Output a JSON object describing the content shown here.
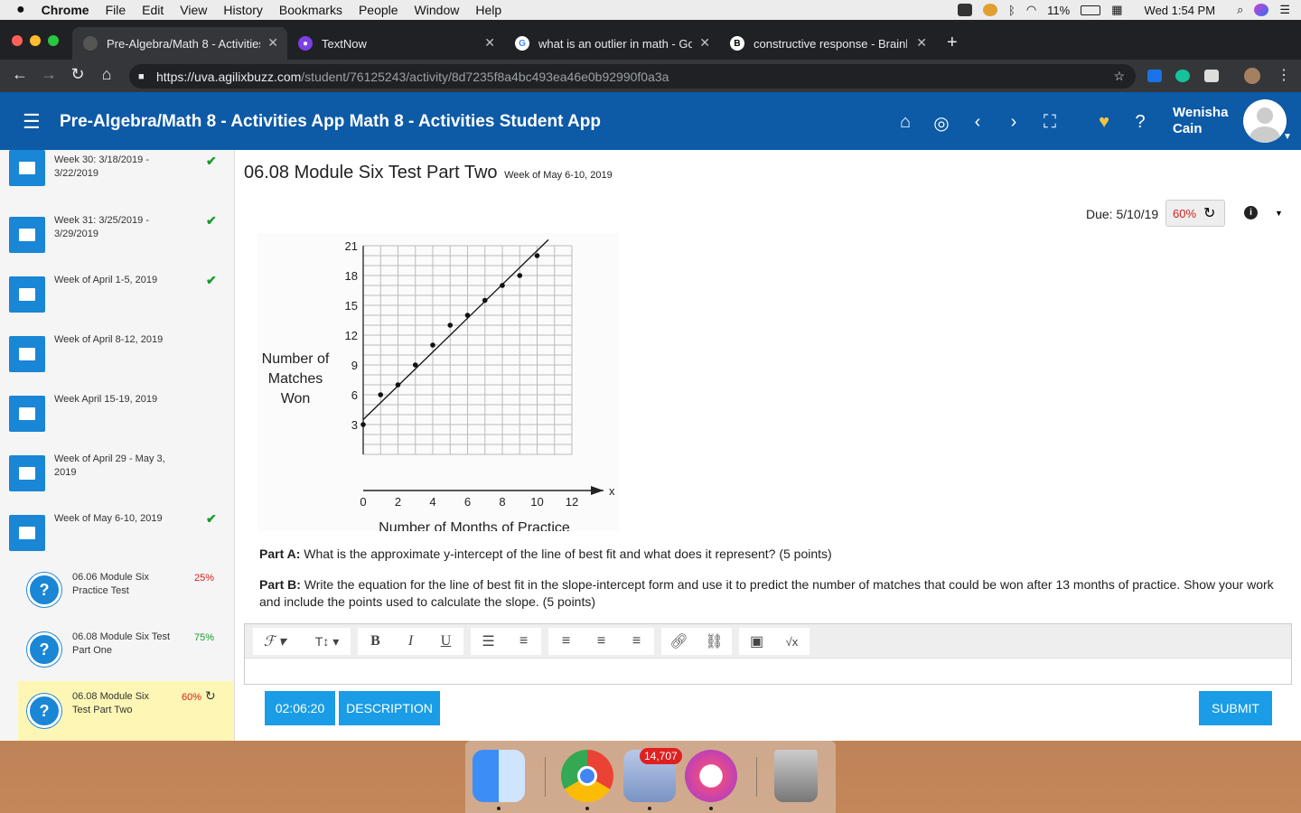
{
  "menubar": {
    "app": "Chrome",
    "items": [
      "File",
      "Edit",
      "View",
      "History",
      "Bookmarks",
      "People",
      "Window",
      "Help"
    ],
    "battery": "11%",
    "clock": "Wed 1:54 PM"
  },
  "tabs": [
    {
      "title": "Pre-Algebra/Math 8 - Activities",
      "active": true
    },
    {
      "title": "TextNow",
      "active": false
    },
    {
      "title": "what is an outlier in math - Goo",
      "active": false
    },
    {
      "title": "constructive response - Brainly",
      "active": false
    }
  ],
  "address": {
    "host": "https://uva.agilixbuzz.com",
    "path": "/student/76125243/activity/8d7235f8a4bc493ea46e0b92990f0a3a"
  },
  "header": {
    "title": "Pre-Algebra/Math 8 - Activities App Math 8 - Activities Student App",
    "user_first": "Wenisha",
    "user_last": "Cain"
  },
  "sidebar": {
    "weeks": [
      {
        "label": "Week 30: 3/18/2019 - 3/22/2019",
        "done": true
      },
      {
        "label": "Week 31: 3/25/2019 - 3/29/2019",
        "done": true
      },
      {
        "label": "Week of April 1-5, 2019",
        "done": true
      },
      {
        "label": "Week of April 8-12, 2019",
        "done": false
      },
      {
        "label": "Week April 15-19, 2019",
        "done": false
      },
      {
        "label": "Week of April 29 - May 3, 2019",
        "done": false
      },
      {
        "label": "Week of May 6-10, 2019",
        "done": true
      }
    ],
    "activities": [
      {
        "label": "06.06 Module Six Practice Test",
        "score": "25%"
      },
      {
        "label": "06.08 Module Six Test Part One",
        "score": "75%"
      },
      {
        "label": "06.08 Module Six Test Part Two",
        "score": "60%"
      }
    ]
  },
  "main": {
    "title": "06.08 Module Six Test Part Two",
    "week": "Week of May 6-10, 2019",
    "due": "Due: 5/10/19",
    "score": "60%",
    "part_a_label": "Part A:",
    "part_a": "What is the approximate y-intercept of the line of best fit and what does it represent? (5 points)",
    "part_b_label": "Part B:",
    "part_b": "Write the equation for the line of best fit in the slope-intercept form and use it to predict the number of matches that could be won after 13 months of practice. Show your work and include the points used to calculate the slope. (5 points)",
    "timer": "02:06:20",
    "description_btn": "DESCRIPTION",
    "submit_btn": "SUBMIT"
  },
  "chart_data": {
    "type": "scatter",
    "xlabel": "Number of Months of Practice",
    "ylabel": "Number of Matches Won",
    "x_axis_name": "x",
    "xlim": [
      0,
      12
    ],
    "ylim": [
      0,
      21
    ],
    "xticks": [
      "0",
      "2",
      "4",
      "6",
      "8",
      "10",
      "12"
    ],
    "yticks": [
      "3",
      "6",
      "9",
      "12",
      "15",
      "18",
      "21"
    ],
    "points": [
      [
        0,
        3
      ],
      [
        1,
        6
      ],
      [
        2,
        7
      ],
      [
        3,
        9
      ],
      [
        4,
        11
      ],
      [
        5,
        13
      ],
      [
        6,
        14
      ],
      [
        7,
        15.5
      ],
      [
        8,
        17
      ],
      [
        9,
        18
      ],
      [
        10,
        20
      ]
    ],
    "fit_line": {
      "slope": 1.7,
      "intercept": 3.5
    }
  },
  "dock": {
    "mail_badge": "14,707"
  }
}
